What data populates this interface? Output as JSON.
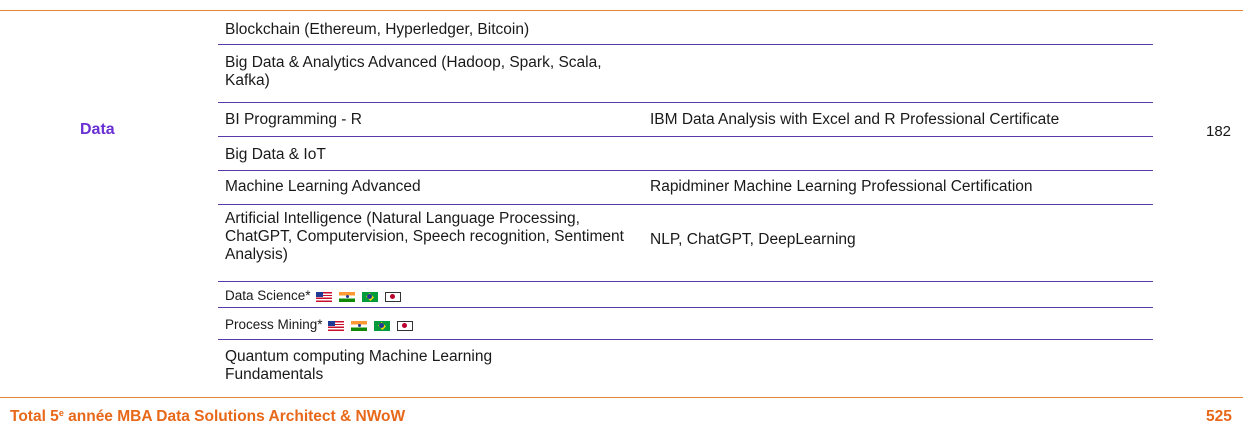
{
  "table": {
    "category": "Data",
    "hours": "182",
    "rows": [
      {
        "course": "Blockchain (Ethereum, Hyperledger, Bitcoin)",
        "cert": ""
      },
      {
        "course": "Big Data & Analytics Advanced (Hadoop, Spark, Scala, Kafka)",
        "cert": ""
      },
      {
        "course": "BI Programming - R",
        "cert": "IBM Data Analysis with Excel and R Professional Certificate"
      },
      {
        "course": "Big Data & IoT",
        "cert": ""
      },
      {
        "course": "Machine Learning Advanced",
        "cert": "Rapidminer Machine Learning Professional Certification"
      },
      {
        "course": "Artificial Intelligence (Natural Language Processing, ChatGPT, Computervision, Speech recognition, Sentiment Analysis)",
        "cert": "NLP, ChatGPT, DeepLearning"
      },
      {
        "course": "Data Science*",
        "cert": "",
        "flags": [
          "us-flag-icon",
          "india-flag-icon",
          "brazil-flag-icon",
          "japan-flag-icon"
        ]
      },
      {
        "course": "Process Mining*",
        "cert": "",
        "flags": [
          "us-flag-icon",
          "india-flag-icon",
          "brazil-flag-icon",
          "japan-flag-icon"
        ]
      },
      {
        "course": "Quantum computing Machine Learning Fundamentals",
        "cert": ""
      }
    ]
  },
  "total": {
    "label_pre": "Total 5",
    "label_sup": "e",
    "label_post": " année MBA Data Solutions Architect & NWoW",
    "value": "525"
  },
  "colors": {
    "accent_orange": "#e8681a",
    "accent_purple": "#6a2fd3",
    "separator": "#5a3aa8"
  }
}
